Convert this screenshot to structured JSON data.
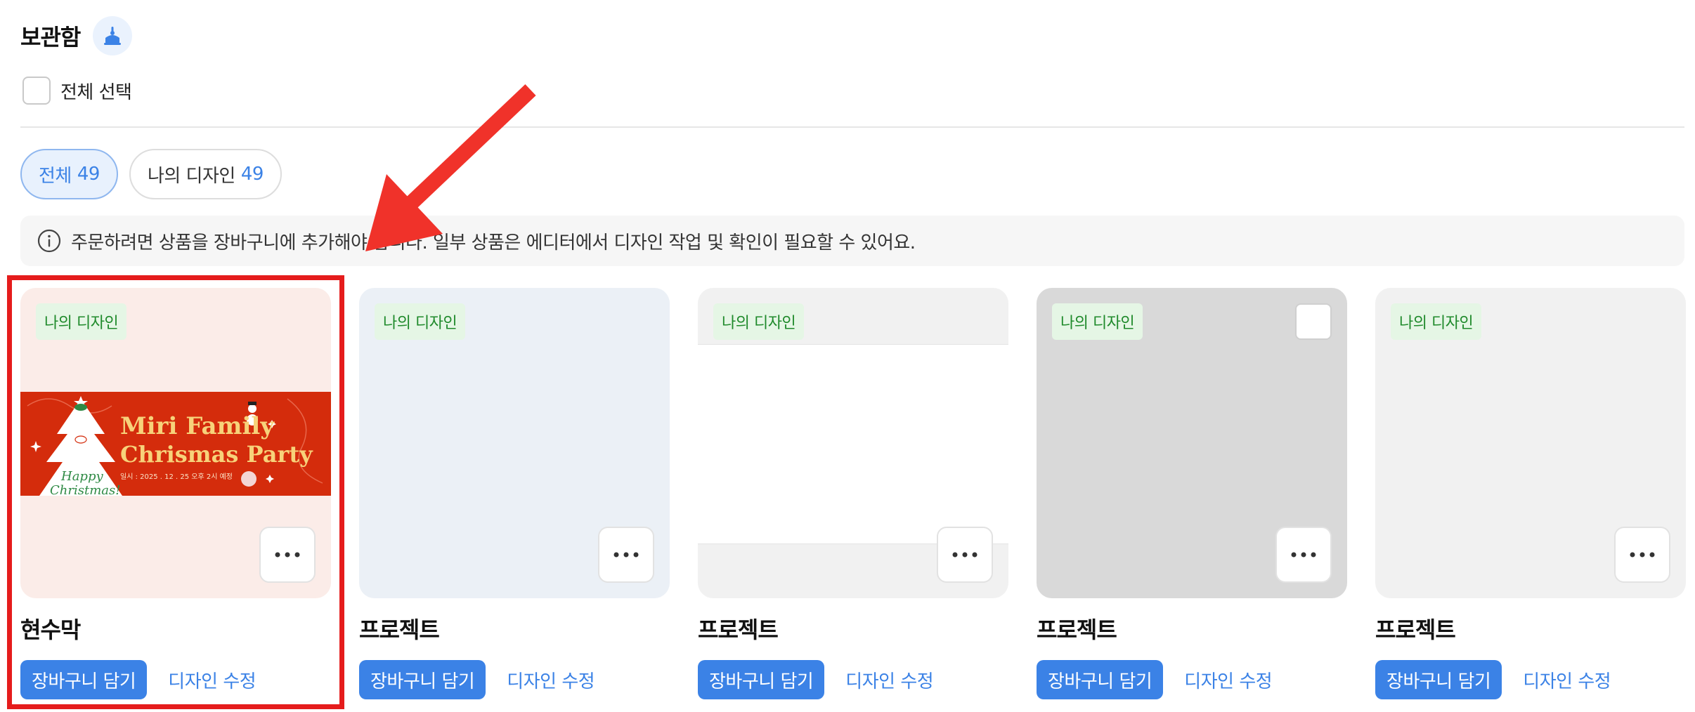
{
  "header": {
    "title": "보관함",
    "icon": "vault-tray-icon"
  },
  "select_all": {
    "label": "전체 선택",
    "checked": false
  },
  "filters": [
    {
      "label": "전체",
      "count": "49",
      "active": true
    },
    {
      "label": "나의 디자인",
      "count": "49",
      "active": false
    }
  ],
  "notice": {
    "text": "주문하려면 상품을 장바구니에 추가해야 합니다. 일부 상품은 에디터에서 디자인 작업 및 확인이 필요할 수 있어요."
  },
  "cards": [
    {
      "badge": "나의 디자인",
      "title": "현수막",
      "cart_label": "장바구니 담기",
      "edit_label": "디자인 수정",
      "background": "#fbece8",
      "banner": {
        "line1": "Miri Family",
        "line2": "Chrismas Party",
        "date": "일시 : 2025 . 12 . 25 오후 2시 예정",
        "script_line1": "Happy",
        "script_line2": "Christmas!",
        "bg_color": "#d42c0c",
        "text_color": "#f7d27a"
      }
    },
    {
      "badge": "나의 디자인",
      "title": "프로젝트",
      "cart_label": "장바구니 담기",
      "edit_label": "디자인 수정",
      "background": "#ebf0f6"
    },
    {
      "badge": "나의 디자인",
      "title": "프로젝트",
      "cart_label": "장바구니 담기",
      "edit_label": "디자인 수정",
      "background": "#f1f1f1"
    },
    {
      "badge": "나의 디자인",
      "title": "프로젝트",
      "cart_label": "장바구니 담기",
      "edit_label": "디자인 수정",
      "background": "#d9d9d9"
    },
    {
      "badge": "나의 디자인",
      "title": "프로젝트",
      "cart_label": "장바구니 담기",
      "edit_label": "디자인 수정",
      "background": "#f1f1f1"
    }
  ],
  "colors": {
    "accent": "#3b82e6",
    "badge_bg": "#e5f6e5",
    "badge_text": "#1f8a2b",
    "highlight": "#e51c1c"
  }
}
